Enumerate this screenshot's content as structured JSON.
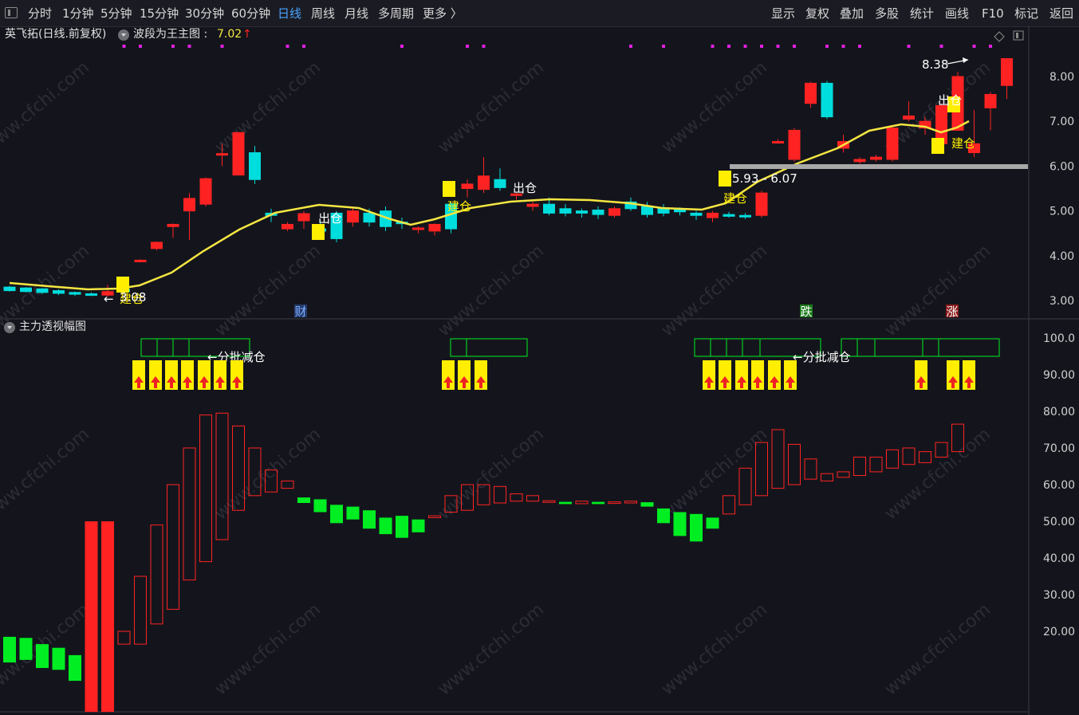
{
  "toolbar": {
    "periods": [
      "分时",
      "1分钟",
      "5分钟",
      "15分钟",
      "30分钟",
      "60分钟",
      "日线",
      "周线",
      "月线",
      "多周期",
      "更多 〉"
    ],
    "active_period": "日线",
    "actions": [
      "显示",
      "复权",
      "叠加",
      "多股",
      "统计",
      "画线",
      "F10",
      "标记",
      "返回"
    ]
  },
  "main_panel": {
    "stock_title": "英飞拓(日线.前复权)",
    "indicator_name": "波段为王主图 :",
    "indicator_value": "7.02",
    "indicator_arrow": "↑",
    "price_labels": [
      "8.00",
      "7.00",
      "6.00",
      "5.00",
      "4.00",
      "3.00"
    ],
    "annotations": {
      "build": "建仓",
      "exit": "出仓",
      "low_value": "3.08",
      "low_arrow": "←",
      "high_value": "8.38",
      "zone_text": "5.93 - 6.07",
      "marker_cai": "财",
      "marker_die": "跌",
      "marker_zhang": "涨"
    }
  },
  "sub_panel": {
    "name": "主力透视幅图",
    "axis_labels": [
      "100.0",
      "90.00",
      "80.00",
      "70.00",
      "60.00",
      "50.00",
      "40.00",
      "30.00",
      "20.00"
    ],
    "batch_reduce": "←分批减仓"
  },
  "watermark": "www.cfchi.com",
  "colors": {
    "background": "#14151c",
    "up": "#ff2222",
    "down": "#00dddd",
    "ma_line": "#f5e642",
    "signal_yellow": "#ffee00",
    "green_bar": "#00ee22",
    "active_tab": "#4aa3ff",
    "magenta_dot": "#e020e0"
  }
}
